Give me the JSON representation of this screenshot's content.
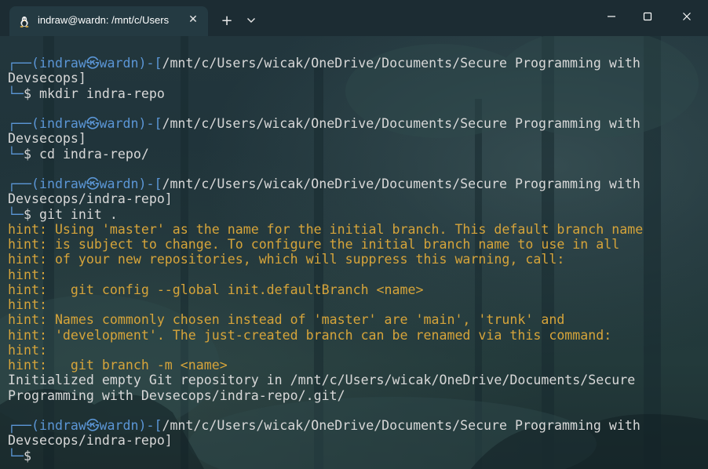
{
  "window": {
    "tab_title": "indraw@wardn: /mnt/c/Users",
    "tab_icon": "linux-penguin-icon",
    "tab_close": "✕",
    "new_tab": "+",
    "dropdown": "chevron-down-icon",
    "controls": [
      "minimize-icon",
      "maximize-icon",
      "close-icon"
    ]
  },
  "colors": {
    "prompt_blue": "#5b96d6",
    "hint_yellow": "#d6a43a",
    "text": "#d8d8d8",
    "background": "#1b2f36"
  },
  "terminal": {
    "lines": [
      {
        "type": "frame",
        "frame": "┌──(",
        "user": "indraw",
        "at": "㉿",
        "host": "wardn",
        "dash": ")-[",
        "path": "/mnt/c/Users/wicak/OneDrive/Documents/Secure Programming with",
        "end": ""
      },
      {
        "type": "cont",
        "text": "Devsecops]"
      },
      {
        "type": "cmd",
        "corner": "└─",
        "dollar": "$",
        "command": " mkdir indra-repo"
      },
      {
        "type": "blank"
      },
      {
        "type": "frame",
        "frame": "┌──(",
        "user": "indraw",
        "at": "㉿",
        "host": "wardn",
        "dash": ")-[",
        "path": "/mnt/c/Users/wicak/OneDrive/Documents/Secure Programming with",
        "end": ""
      },
      {
        "type": "cont",
        "text": "Devsecops]"
      },
      {
        "type": "cmd",
        "corner": "└─",
        "dollar": "$",
        "command": " cd indra-repo/"
      },
      {
        "type": "blank"
      },
      {
        "type": "frame",
        "frame": "┌──(",
        "user": "indraw",
        "at": "㉿",
        "host": "wardn",
        "dash": ")-[",
        "path": "/mnt/c/Users/wicak/OneDrive/Documents/Secure Programming with",
        "end": ""
      },
      {
        "type": "cont",
        "text": "Devsecops/indra-repo]"
      },
      {
        "type": "cmd",
        "corner": "└─",
        "dollar": "$",
        "command": " git init ."
      },
      {
        "type": "hint",
        "text": "hint: Using 'master' as the name for the initial branch. This default branch name"
      },
      {
        "type": "hint",
        "text": "hint: is subject to change. To configure the initial branch name to use in all"
      },
      {
        "type": "hint",
        "text": "hint: of your new repositories, which will suppress this warning, call:"
      },
      {
        "type": "hint",
        "text": "hint:"
      },
      {
        "type": "hint",
        "text": "hint:   git config --global init.defaultBranch <name>"
      },
      {
        "type": "hint",
        "text": "hint:"
      },
      {
        "type": "hint",
        "text": "hint: Names commonly chosen instead of 'master' are 'main', 'trunk' and"
      },
      {
        "type": "hint",
        "text": "hint: 'development'. The just-created branch can be renamed via this command:"
      },
      {
        "type": "hint",
        "text": "hint:"
      },
      {
        "type": "hint",
        "text": "hint:   git branch -m <name>"
      },
      {
        "type": "out",
        "text": "Initialized empty Git repository in /mnt/c/Users/wicak/OneDrive/Documents/Secure"
      },
      {
        "type": "out",
        "text": "Programming with Devsecops/indra-repo/.git/"
      },
      {
        "type": "blank"
      },
      {
        "type": "frame",
        "frame": "┌──(",
        "user": "indraw",
        "at": "㉿",
        "host": "wardn",
        "dash": ")-[",
        "path": "/mnt/c/Users/wicak/OneDrive/Documents/Secure Programming with",
        "end": ""
      },
      {
        "type": "cont",
        "text": "Devsecops/indra-repo]"
      },
      {
        "type": "cmd",
        "corner": "└─",
        "dollar": "$",
        "command": ""
      }
    ]
  }
}
